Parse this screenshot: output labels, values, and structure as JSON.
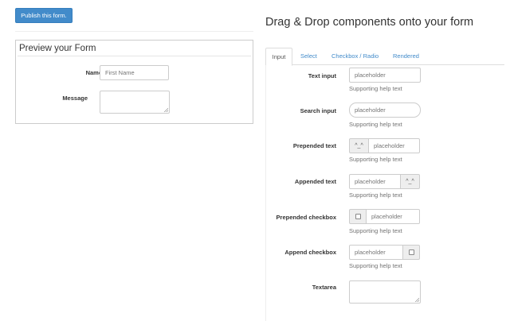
{
  "toolbar": {
    "publish_label": "Publish this form."
  },
  "preview": {
    "title": "Preview your Form",
    "name_label": "Name",
    "name_placeholder": "First Name",
    "message_label": "Message"
  },
  "components": {
    "title": "Drag & Drop components onto your form",
    "tabs": [
      {
        "label": "Input",
        "active": true
      },
      {
        "label": "Select",
        "active": false
      },
      {
        "label": "Checkbox / Radio",
        "active": false
      },
      {
        "label": "Rendered",
        "active": false
      }
    ],
    "placeholder": "placeholder",
    "help_text": "Supporting help text",
    "addon_text": "^_^",
    "items": {
      "text_input": "Text input",
      "search_input": "Search input",
      "prepended_text": "Prepended text",
      "appended_text": "Appended text",
      "prepended_checkbox": "Prepended checkbox",
      "append_checkbox": "Append checkbox",
      "textarea": "Textarea"
    }
  },
  "colors": {
    "primary": "#428bca",
    "border": "#cccccc",
    "addon_bg": "#eeeeee"
  }
}
